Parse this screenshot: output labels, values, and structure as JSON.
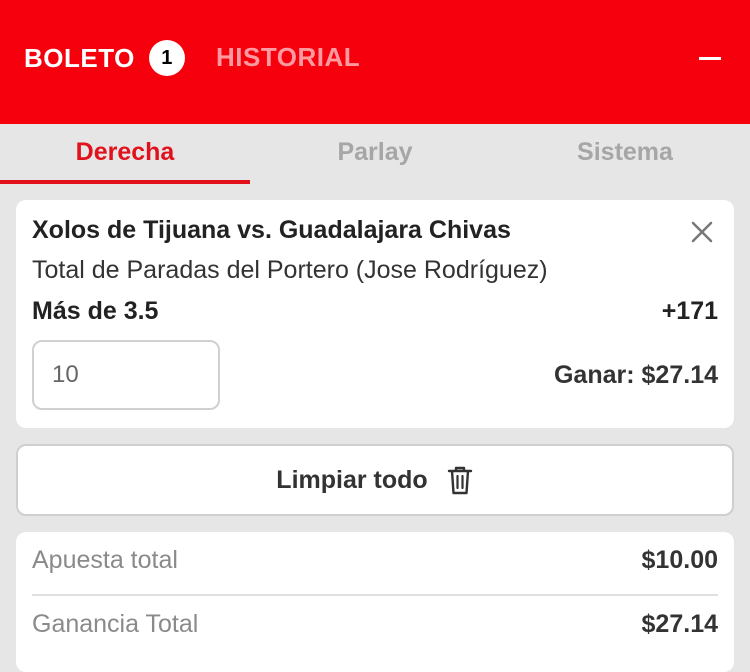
{
  "header": {
    "tab_boleto": "BOLETO",
    "badge_count": "1",
    "tab_historial": "HISTORIAL",
    "collapse_icon": "minus-icon",
    "colors": {
      "brand_red": "#f5000c",
      "inactive_tab_text": "#ff9aa0"
    }
  },
  "bet_type_tabs": [
    {
      "label": "Derecha",
      "active": true
    },
    {
      "label": "Parlay",
      "active": false
    },
    {
      "label": "Sistema",
      "active": false
    }
  ],
  "selection_card": {
    "match": "Xolos de Tijuana vs. Guadalajara Chivas",
    "market": "Total de Paradas del Portero (Jose Rodríguez)",
    "pick": "Más de 3.5",
    "odds": "+171",
    "stake_value": "10",
    "win_label": "Ganar:",
    "win_amount": "$27.14",
    "remove_icon": "close-icon"
  },
  "clear_button": {
    "label": "Limpiar todo",
    "icon": "trash-icon"
  },
  "summary": {
    "total_stake_label": "Apuesta total",
    "total_stake_value": "$10.00",
    "total_win_label": "Ganancia Total",
    "total_win_value": "$27.14"
  },
  "accent_color": "#e2121c"
}
